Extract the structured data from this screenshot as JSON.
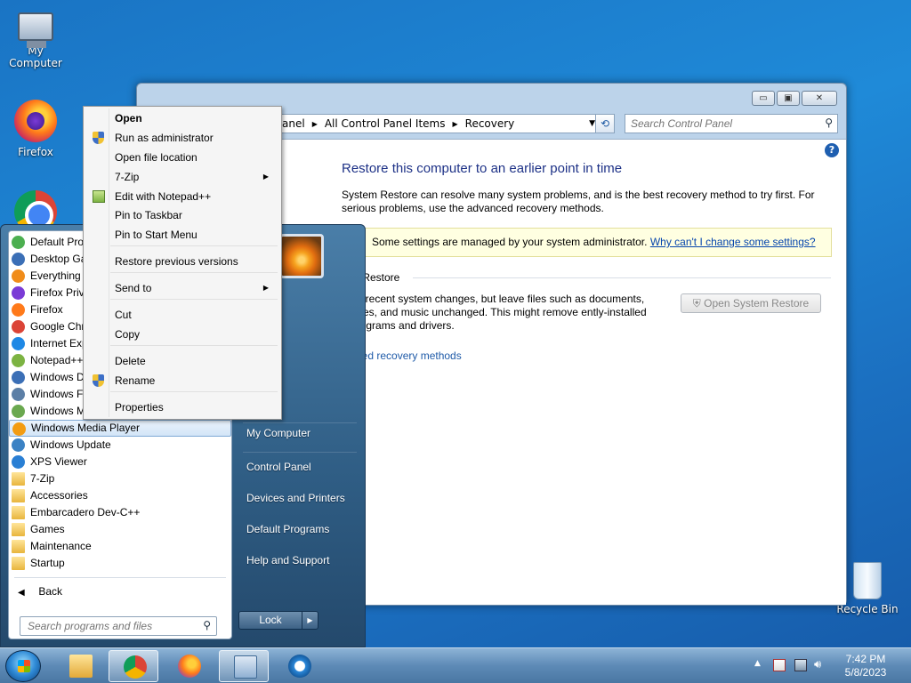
{
  "desktop": {
    "icons": [
      {
        "label": "My Computer"
      },
      {
        "label": "Firefox"
      },
      {
        "label": "Recycle Bin"
      }
    ]
  },
  "window": {
    "breadcrumb": [
      "anel",
      "All Control Panel Items",
      "Recovery"
    ],
    "search_placeholder": "Search Control Panel",
    "buttons": {
      "minimize": "▭",
      "maximize": "▣",
      "close": "✕"
    },
    "title": "Restore this computer to an earlier point in time",
    "description": "System Restore can resolve many system problems, and is the best recovery method to try first. For serious problems, use the advanced recovery methods.",
    "admin_notice": "Some settings are managed by your system administrator.",
    "admin_link": "Why can't I change some settings?",
    "section_label": "m Restore",
    "section_desc": "do recent system changes, but leave files such as documents, tures, and music unchanged. This might remove ently-installed programs and drivers.",
    "open_restore_button": "Open System Restore",
    "advanced_link": "nced recovery methods"
  },
  "start_menu": {
    "programs": [
      {
        "label": "Default Pro",
        "color": "#4caf50"
      },
      {
        "label": "Desktop Ga",
        "color": "#3b6fb6"
      },
      {
        "label": "Everything",
        "color": "#f08c1a"
      },
      {
        "label": "Firefox Priva",
        "color": "#7a3bd6"
      },
      {
        "label": "Firefox",
        "color": "#ff7a1a"
      },
      {
        "label": "Google Chr",
        "color": "#db4437"
      },
      {
        "label": "Internet Exp",
        "color": "#1e88e5"
      },
      {
        "label": "Notepad++",
        "color": "#7cb342"
      },
      {
        "label": "Windows D",
        "color": "#3b6fb6"
      },
      {
        "label": "Windows Fa",
        "color": "#5c7fa6"
      },
      {
        "label": "Windows M",
        "color": "#6aa84f"
      },
      {
        "label": "Windows Media Player",
        "color": "#f39c12"
      },
      {
        "label": "Windows Update",
        "color": "#3b82c4"
      },
      {
        "label": "XPS Viewer",
        "color": "#2a7fd4"
      },
      {
        "label": "7-Zip",
        "color": "folder"
      },
      {
        "label": "Accessories",
        "color": "folder"
      },
      {
        "label": "Embarcadero Dev-C++",
        "color": "folder"
      },
      {
        "label": "Games",
        "color": "folder"
      },
      {
        "label": "Maintenance",
        "color": "folder"
      },
      {
        "label": "Startup",
        "color": "folder"
      }
    ],
    "highlighted_index": 11,
    "back_label": "Back",
    "search_placeholder": "Search programs and files",
    "right_links": [
      "ents",
      "s",
      "My Computer",
      "Control Panel",
      "Devices and Printers",
      "Default Programs",
      "Help and Support"
    ],
    "lock_label": "Lock"
  },
  "context_menu": {
    "items": [
      {
        "label": "Open",
        "bold": true
      },
      {
        "label": "Run as administrator",
        "icon": "shield-icon"
      },
      {
        "label": "Open file location"
      },
      {
        "label": "7-Zip",
        "submenu": true
      },
      {
        "label": "Edit with Notepad++",
        "icon": "notepad-plus-icon"
      },
      {
        "label": "Pin to Taskbar"
      },
      {
        "label": "Pin to Start Menu"
      },
      {
        "label": "Restore previous versions"
      },
      {
        "label": "Send to",
        "submenu": true
      },
      {
        "label": "Cut"
      },
      {
        "label": "Copy"
      },
      {
        "label": "Delete"
      },
      {
        "label": "Rename",
        "icon": "shield-icon"
      },
      {
        "label": "Properties"
      }
    ]
  },
  "taskbar": {
    "time": "7:42 PM",
    "date": "5/8/2023"
  }
}
